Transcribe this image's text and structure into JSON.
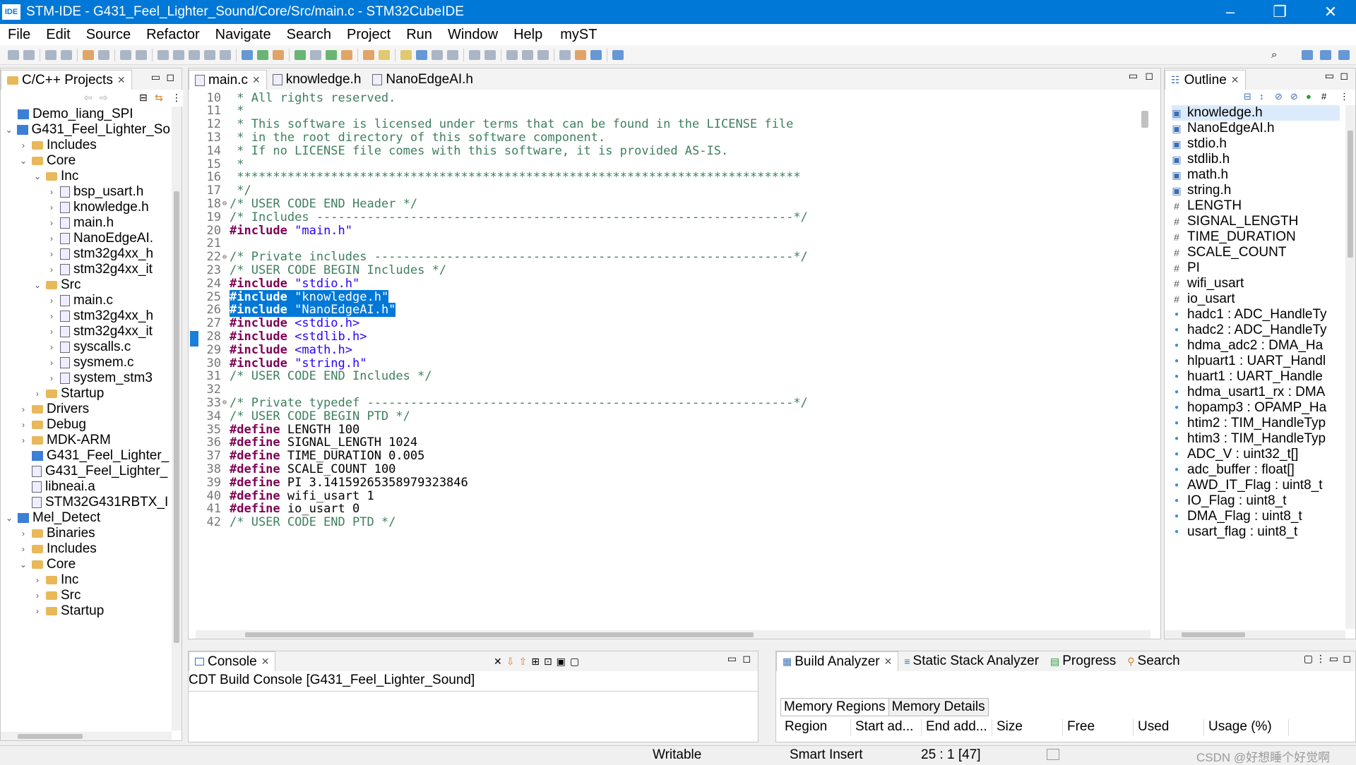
{
  "window": {
    "title": "STM-IDE - G431_Feel_Lighter_Sound/Core/Src/main.c - STM32CubeIDE",
    "logo": "IDE"
  },
  "menu": [
    "File",
    "Edit",
    "Source",
    "Refactor",
    "Navigate",
    "Search",
    "Project",
    "Run",
    "Window",
    "Help",
    "myST"
  ],
  "projects_panel": {
    "tab_label": "C/C++ Projects",
    "tree": [
      {
        "label": "Demo_liang_SPI",
        "depth": 0,
        "arrow": "",
        "icon": "project"
      },
      {
        "label": "G431_Feel_Lighter_So",
        "depth": 0,
        "arrow": "v",
        "icon": "project"
      },
      {
        "label": "Includes",
        "depth": 1,
        "arrow": ">",
        "icon": "folder"
      },
      {
        "label": "Core",
        "depth": 1,
        "arrow": "v",
        "icon": "folder"
      },
      {
        "label": "Inc",
        "depth": 2,
        "arrow": "v",
        "icon": "folder"
      },
      {
        "label": "bsp_usart.h",
        "depth": 3,
        "arrow": ">",
        "icon": "file"
      },
      {
        "label": "knowledge.h",
        "depth": 3,
        "arrow": ">",
        "icon": "file"
      },
      {
        "label": "main.h",
        "depth": 3,
        "arrow": ">",
        "icon": "file"
      },
      {
        "label": "NanoEdgeAI.",
        "depth": 3,
        "arrow": ">",
        "icon": "file"
      },
      {
        "label": "stm32g4xx_h",
        "depth": 3,
        "arrow": ">",
        "icon": "file"
      },
      {
        "label": "stm32g4xx_it",
        "depth": 3,
        "arrow": ">",
        "icon": "file"
      },
      {
        "label": "Src",
        "depth": 2,
        "arrow": "v",
        "icon": "folder"
      },
      {
        "label": "main.c",
        "depth": 3,
        "arrow": ">",
        "icon": "file"
      },
      {
        "label": "stm32g4xx_h",
        "depth": 3,
        "arrow": ">",
        "icon": "file"
      },
      {
        "label": "stm32g4xx_it",
        "depth": 3,
        "arrow": ">",
        "icon": "file"
      },
      {
        "label": "syscalls.c",
        "depth": 3,
        "arrow": ">",
        "icon": "file"
      },
      {
        "label": "sysmem.c",
        "depth": 3,
        "arrow": ">",
        "icon": "file"
      },
      {
        "label": "system_stm3",
        "depth": 3,
        "arrow": ">",
        "icon": "file"
      },
      {
        "label": "Startup",
        "depth": 2,
        "arrow": ">",
        "icon": "folder"
      },
      {
        "label": "Drivers",
        "depth": 1,
        "arrow": ">",
        "icon": "folder"
      },
      {
        "label": "Debug",
        "depth": 1,
        "arrow": ">",
        "icon": "folder"
      },
      {
        "label": "MDK-ARM",
        "depth": 1,
        "arrow": ">",
        "icon": "folder"
      },
      {
        "label": "G431_Feel_Lighter_",
        "depth": 1,
        "arrow": "",
        "icon": "project"
      },
      {
        "label": "G431_Feel_Lighter_",
        "depth": 1,
        "arrow": "",
        "icon": "file"
      },
      {
        "label": "libneai.a",
        "depth": 1,
        "arrow": "",
        "icon": "file"
      },
      {
        "label": "STM32G431RBTX_I",
        "depth": 1,
        "arrow": "",
        "icon": "file"
      },
      {
        "label": "Mel_Detect",
        "depth": 0,
        "arrow": "v",
        "icon": "project"
      },
      {
        "label": "Binaries",
        "depth": 1,
        "arrow": ">",
        "icon": "folder"
      },
      {
        "label": "Includes",
        "depth": 1,
        "arrow": ">",
        "icon": "folder"
      },
      {
        "label": "Core",
        "depth": 1,
        "arrow": "v",
        "icon": "folder"
      },
      {
        "label": "Inc",
        "depth": 2,
        "arrow": ">",
        "icon": "folder"
      },
      {
        "label": "Src",
        "depth": 2,
        "arrow": ">",
        "icon": "folder"
      },
      {
        "label": "Startup",
        "depth": 2,
        "arrow": ">",
        "icon": "folder"
      }
    ]
  },
  "editor": {
    "tabs": [
      {
        "label": "main.c",
        "active": true,
        "closable": true
      },
      {
        "label": "knowledge.h",
        "active": false,
        "closable": false
      },
      {
        "label": "NanoEdgeAI.h",
        "active": false,
        "closable": false
      }
    ],
    "lines": [
      {
        "n": "10",
        "fold": "",
        "hl": false,
        "parts": [
          [
            "cm",
            " * All rights reserved."
          ]
        ]
      },
      {
        "n": "11",
        "fold": "",
        "hl": false,
        "parts": [
          [
            "cm",
            " *"
          ]
        ]
      },
      {
        "n": "12",
        "fold": "",
        "hl": false,
        "parts": [
          [
            "cm",
            " * This software is licensed under terms that can be found in the LICENSE file"
          ]
        ]
      },
      {
        "n": "13",
        "fold": "",
        "hl": false,
        "parts": [
          [
            "cm",
            " * in the root directory of this software component."
          ]
        ]
      },
      {
        "n": "14",
        "fold": "",
        "hl": false,
        "parts": [
          [
            "cm",
            " * If no LICENSE file comes with this software, it is provided AS-IS."
          ]
        ]
      },
      {
        "n": "15",
        "fold": "",
        "hl": false,
        "parts": [
          [
            "cm",
            " *"
          ]
        ]
      },
      {
        "n": "16",
        "fold": "",
        "hl": false,
        "parts": [
          [
            "cm",
            " ******************************************************************************"
          ]
        ]
      },
      {
        "n": "17",
        "fold": "",
        "hl": false,
        "parts": [
          [
            "cm",
            " */"
          ]
        ]
      },
      {
        "n": "18",
        "fold": "⊖",
        "hl": false,
        "parts": [
          [
            "cm",
            "/* USER CODE END Header */"
          ]
        ]
      },
      {
        "n": "19",
        "fold": "",
        "hl": false,
        "parts": [
          [
            "cm",
            "/* Includes ------------------------------------------------------------------*/"
          ]
        ]
      },
      {
        "n": "20",
        "fold": "",
        "hl": false,
        "parts": [
          [
            "kw",
            "#include"
          ],
          [
            "st",
            " \"main.h\""
          ]
        ]
      },
      {
        "n": "21",
        "fold": "",
        "hl": false,
        "parts": []
      },
      {
        "n": "22",
        "fold": "⊖",
        "hl": false,
        "parts": [
          [
            "cm",
            "/* Private includes ----------------------------------------------------------*/"
          ]
        ]
      },
      {
        "n": "23",
        "fold": "",
        "hl": false,
        "parts": [
          [
            "cm",
            "/* USER CODE BEGIN Includes */"
          ]
        ]
      },
      {
        "n": "24",
        "fold": "",
        "hl": false,
        "parts": [
          [
            "kw",
            "#include"
          ],
          [
            "st",
            " \"stdio.h\""
          ]
        ]
      },
      {
        "n": "25",
        "fold": "",
        "hl": true,
        "parts": [
          [
            "kw",
            "#include"
          ],
          [
            "st",
            " \"knowledge.h\""
          ]
        ]
      },
      {
        "n": "26",
        "fold": "",
        "hl": true,
        "parts": [
          [
            "kw",
            "#include"
          ],
          [
            "st",
            " \"NanoEdgeAI.h\""
          ]
        ]
      },
      {
        "n": "27",
        "fold": "",
        "hl": false,
        "parts": [
          [
            "kw",
            "#include"
          ],
          [
            "st",
            " <stdio.h>"
          ]
        ]
      },
      {
        "n": "28",
        "fold": "",
        "hl": false,
        "parts": [
          [
            "kw",
            "#include"
          ],
          [
            "st",
            " <stdlib.h>"
          ]
        ]
      },
      {
        "n": "29",
        "fold": "",
        "hl": false,
        "parts": [
          [
            "kw",
            "#include"
          ],
          [
            "st",
            " <math.h>"
          ]
        ]
      },
      {
        "n": "30",
        "fold": "",
        "hl": false,
        "parts": [
          [
            "kw",
            "#include"
          ],
          [
            "st",
            " \"string.h\""
          ]
        ]
      },
      {
        "n": "31",
        "fold": "",
        "hl": false,
        "parts": [
          [
            "cm",
            "/* USER CODE END Includes */"
          ]
        ]
      },
      {
        "n": "32",
        "fold": "",
        "hl": false,
        "parts": []
      },
      {
        "n": "33",
        "fold": "⊖",
        "hl": false,
        "parts": [
          [
            "cm",
            "/* Private typedef -----------------------------------------------------------*/"
          ]
        ]
      },
      {
        "n": "34",
        "fold": "",
        "hl": false,
        "parts": [
          [
            "cm",
            "/* USER CODE BEGIN PTD */"
          ]
        ]
      },
      {
        "n": "35",
        "fold": "",
        "hl": false,
        "parts": [
          [
            "kw",
            "#define"
          ],
          [
            "",
            " LENGTH 100"
          ]
        ]
      },
      {
        "n": "36",
        "fold": "",
        "hl": false,
        "parts": [
          [
            "kw",
            "#define"
          ],
          [
            "",
            " SIGNAL_LENGTH 1024"
          ]
        ]
      },
      {
        "n": "37",
        "fold": "",
        "hl": false,
        "parts": [
          [
            "kw",
            "#define"
          ],
          [
            "",
            " TIME_DURATION 0.005"
          ]
        ]
      },
      {
        "n": "38",
        "fold": "",
        "hl": false,
        "parts": [
          [
            "kw",
            "#define"
          ],
          [
            "",
            " SCALE_COUNT 100"
          ]
        ]
      },
      {
        "n": "39",
        "fold": "",
        "hl": false,
        "parts": [
          [
            "kw",
            "#define"
          ],
          [
            "",
            " PI 3.14159265358979323846"
          ]
        ]
      },
      {
        "n": "40",
        "fold": "",
        "hl": false,
        "parts": [
          [
            "kw",
            "#define"
          ],
          [
            "",
            " wifi_usart 1"
          ]
        ]
      },
      {
        "n": "41",
        "fold": "",
        "hl": false,
        "parts": [
          [
            "kw",
            "#define"
          ],
          [
            "",
            " io_usart 0"
          ]
        ]
      },
      {
        "n": "42",
        "fold": "",
        "hl": false,
        "parts": [
          [
            "cm",
            "/* USER CODE END PTD */"
          ]
        ]
      }
    ]
  },
  "outline": {
    "tab_label": "Outline",
    "items": [
      {
        "icon": "include",
        "label": "knowledge.h",
        "selected": true
      },
      {
        "icon": "include",
        "label": "NanoEdgeAI.h"
      },
      {
        "icon": "include",
        "label": "stdio.h"
      },
      {
        "icon": "include",
        "label": "stdlib.h"
      },
      {
        "icon": "include",
        "label": "math.h"
      },
      {
        "icon": "include",
        "label": "string.h"
      },
      {
        "icon": "define",
        "label": "LENGTH"
      },
      {
        "icon": "define",
        "label": "SIGNAL_LENGTH"
      },
      {
        "icon": "define",
        "label": "TIME_DURATION"
      },
      {
        "icon": "define",
        "label": "SCALE_COUNT"
      },
      {
        "icon": "define",
        "label": "PI"
      },
      {
        "icon": "define",
        "label": "wifi_usart"
      },
      {
        "icon": "define",
        "label": "io_usart"
      },
      {
        "icon": "variable",
        "label": "hadc1 : ADC_HandleTy"
      },
      {
        "icon": "variable",
        "label": "hadc2 : ADC_HandleTy"
      },
      {
        "icon": "variable",
        "label": "hdma_adc2 : DMA_Ha"
      },
      {
        "icon": "variable",
        "label": "hlpuart1 : UART_Handl"
      },
      {
        "icon": "variable",
        "label": "huart1 : UART_Handle"
      },
      {
        "icon": "variable",
        "label": "hdma_usart1_rx : DMA"
      },
      {
        "icon": "variable",
        "label": "hopamp3 : OPAMP_Ha"
      },
      {
        "icon": "variable",
        "label": "htim2 : TIM_HandleTyp"
      },
      {
        "icon": "variable",
        "label": "htim3 : TIM_HandleTyp"
      },
      {
        "icon": "variable",
        "label": "ADC_V : uint32_t[]"
      },
      {
        "icon": "variable",
        "label": "adc_buffer : float[]"
      },
      {
        "icon": "variable",
        "label": "AWD_IT_Flag : uint8_t"
      },
      {
        "icon": "variable",
        "label": "IO_Flag : uint8_t"
      },
      {
        "icon": "variable",
        "label": "DMA_Flag : uint8_t"
      },
      {
        "icon": "variable",
        "label": "usart_flag : uint8_t"
      }
    ]
  },
  "console": {
    "tab_label": "Console",
    "title": "CDT Build Console [G431_Feel_Lighter_Sound]"
  },
  "build_analyzer": {
    "tabs": [
      "Build Analyzer",
      "Static Stack Analyzer",
      "Progress",
      "Search"
    ],
    "subtabs": [
      "Memory Regions",
      "Memory Details"
    ],
    "columns": [
      "Region",
      "Start ad...",
      "End add...",
      "Size",
      "Free",
      "Used",
      "Usage (%)"
    ]
  },
  "status": {
    "writable": "Writable",
    "insert_mode": "Smart Insert",
    "position": "25 : 1 [47]",
    "watermark": "CSDN @好想睡个好觉啊"
  }
}
